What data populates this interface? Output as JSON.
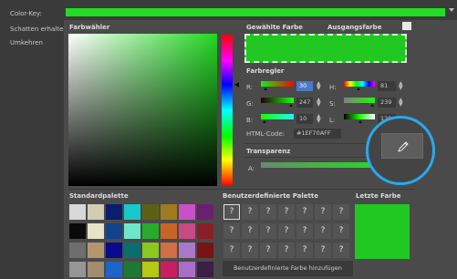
{
  "sidebar": {
    "items": [
      "Color-Key:",
      "Schatten erhalten",
      "Umkehren"
    ]
  },
  "topbar": {
    "color": "#22dd22"
  },
  "dialog": {
    "picker_title": "Farbwähler",
    "selected_title": "Gewählte Farbe",
    "original_title": "Ausgangsfarbe",
    "sliders_title": "Farbregler",
    "channels": {
      "R": {
        "label": "R:",
        "value": "30"
      },
      "G": {
        "label": "G:",
        "value": "247"
      },
      "B": {
        "label": "B:",
        "value": "10"
      },
      "H": {
        "label": "H:",
        "value": "81"
      },
      "S": {
        "label": "S:",
        "value": "239"
      },
      "L": {
        "label": "L:",
        "value": "128"
      }
    },
    "html_code_label": "HTML-Code:",
    "html_code_value": "#1EF70AFF",
    "transparency_title": "Transparenz",
    "alpha_label": "A:",
    "standard_palette_title": "Standardpalette",
    "custom_palette_title": "Benutzerdefinierte Palette",
    "last_color_title": "Letzte Farbe",
    "add_custom_button": "Benutzerdefinierte Farbe hinzufügen",
    "question_mark": "?",
    "selected_color": "#22c822",
    "last_color": "#22c822"
  },
  "standard_palette": [
    [
      "#d8d8d8",
      "#d2ccb4",
      "#0a1e6e",
      "#19c8c8",
      "#5f5f14",
      "#a07a1e",
      "#c850c8",
      "#6e1e6e"
    ],
    [
      "#0a0a0a",
      "#e8e2c8",
      "#12428a",
      "#6ee6c8",
      "#2aaa2a",
      "#c86428",
      "#c84a82",
      "#8a1e28"
    ],
    [
      "#6e6e6e",
      "#b4966e",
      "#0a0a8c",
      "#0a6e6e",
      "#8ac81e",
      "#d26e46",
      "#aa78c8",
      "#781414"
    ],
    [
      "#969696",
      "#a08c6e",
      "#1e64c8",
      "#1e7832",
      "#b4c814",
      "#c81e64",
      "#aa6ec8",
      "#3c1e46"
    ]
  ],
  "eyedropper_icon": "eyedropper-icon"
}
